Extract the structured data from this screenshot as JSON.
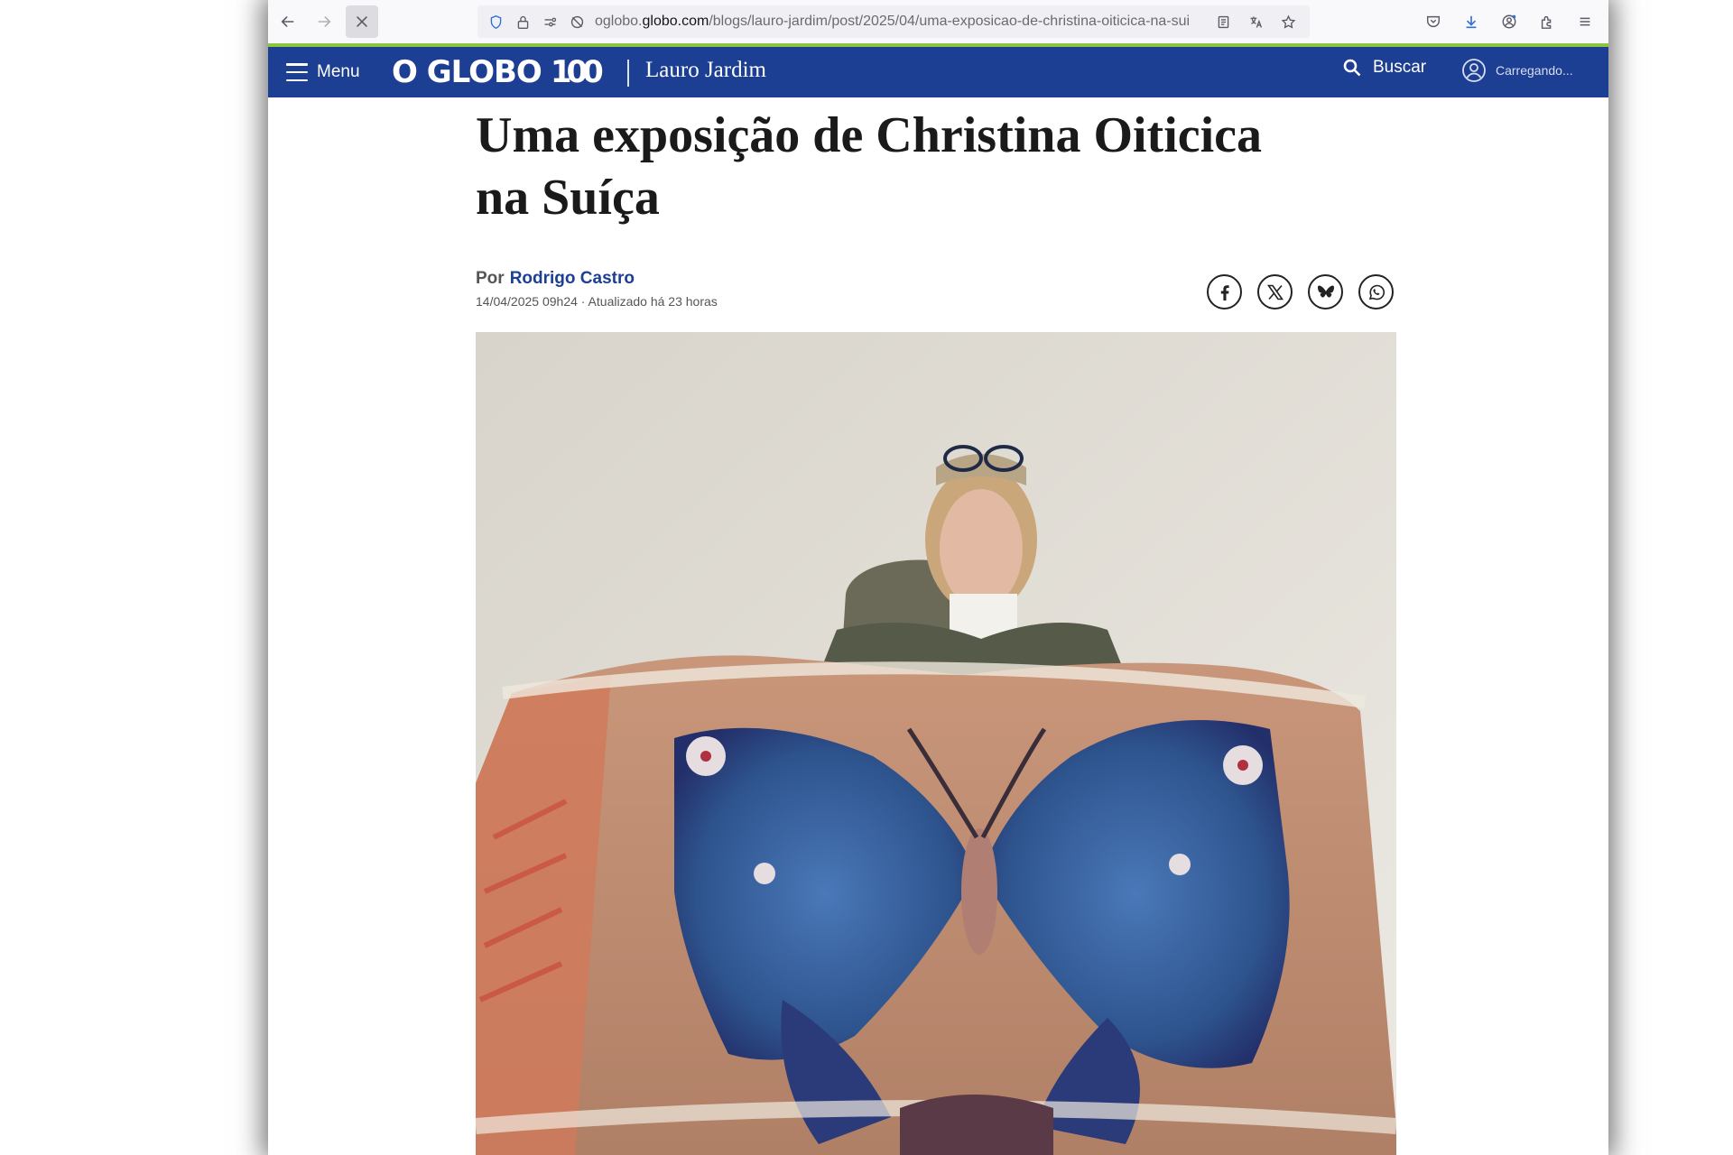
{
  "browser": {
    "url_prefix": "oglobo.",
    "url_domain": "globo.com",
    "url_path": "/blogs/lauro-jardim/post/2025/04/uma-exposicao-de-christina-oiticica-na-sui"
  },
  "header": {
    "menu_label": "Menu",
    "logo_text": "O GLOBO",
    "logo_badge": "100",
    "blog_name": "Lauro Jardim",
    "search_label": "Buscar",
    "user_label": "Carregando..."
  },
  "article": {
    "headline": "Uma exposição de Christina Oiticica na Suíça",
    "byline_prefix": "Por",
    "author": "Rodrigo Castro",
    "dateline": "14/04/2025 09h24 · Atualizado há 23 horas"
  },
  "share": [
    "facebook",
    "x",
    "bluesky",
    "whatsapp"
  ],
  "colors": {
    "header_bg": "#1c3f94",
    "accent_line": "#8cc63f",
    "author_link": "#1c3f94"
  }
}
